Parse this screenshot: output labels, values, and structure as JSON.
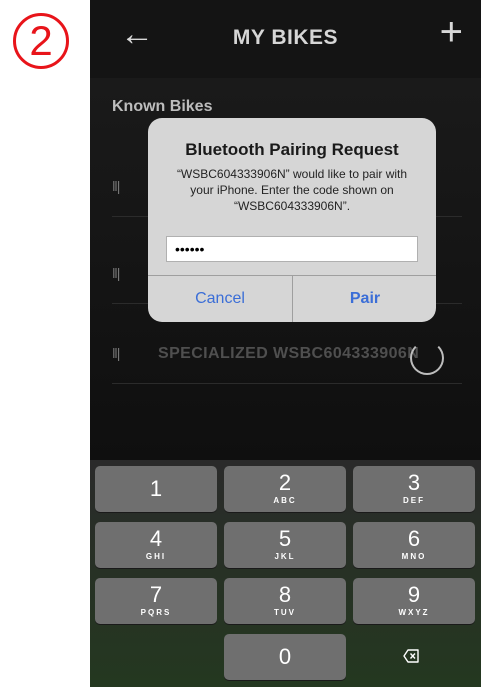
{
  "step_marker": "2",
  "header": {
    "back_glyph": "←",
    "title": "MY BIKES",
    "add_glyph": "+"
  },
  "list": {
    "section_label": "Known Bikes",
    "rows": [
      {
        "signal": "‖|",
        "name": ""
      },
      {
        "signal": "‖|",
        "name": ""
      },
      {
        "signal": "‖|",
        "name": "SPECIALIZED WSBC604333906N"
      }
    ]
  },
  "dialog": {
    "title": "Bluetooth Pairing Request",
    "message": "“WSBC604333906N” would like to pair with your iPhone. Enter the code shown on “WSBC604333906N”.",
    "code_value": "••••••",
    "cancel_label": "Cancel",
    "pair_label": "Pair"
  },
  "keypad": {
    "keys": [
      {
        "num": "1",
        "letters": ""
      },
      {
        "num": "2",
        "letters": "ABC"
      },
      {
        "num": "3",
        "letters": "DEF"
      },
      {
        "num": "4",
        "letters": "GHI"
      },
      {
        "num": "5",
        "letters": "JKL"
      },
      {
        "num": "6",
        "letters": "MNO"
      },
      {
        "num": "7",
        "letters": "PQRS"
      },
      {
        "num": "8",
        "letters": "TUV"
      },
      {
        "num": "9",
        "letters": "WXYZ"
      },
      {
        "num": "0",
        "letters": ""
      }
    ],
    "delete_icon": "backspace-icon"
  },
  "colors": {
    "accent_red": "#e8141a",
    "ios_blue": "#3b6ed7",
    "key_gray": "#6f6f6f"
  }
}
